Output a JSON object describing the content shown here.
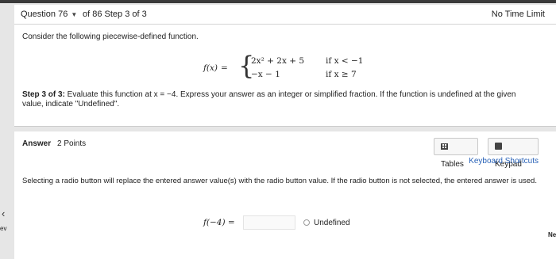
{
  "header": {
    "question_label": "Question 76",
    "of_step": "of 86 Step 3 of 3",
    "time_limit": "No Time Limit"
  },
  "question": {
    "prompt": "Consider the following piecewise-defined function.",
    "function_name": "f(x)",
    "equals": "=",
    "case1_expr": "2x² + 2x + 5",
    "case1_cond": "if x < −1",
    "case2_expr": "−x − 1",
    "case2_cond": "if x ≥ 7",
    "step_label": "Step 3 of 3:",
    "step_text": " Evaluate this function at x = −4. Express your answer as an integer or simplified fraction. If the function is undefined at the given value, indicate \"Undefined\"."
  },
  "answer": {
    "label": "Answer",
    "points": "2 Points",
    "tables_label": "Tables",
    "keypad_label": "Keypad",
    "keyboard_shortcuts": "Keyboard Shortcuts",
    "note": "Selecting a radio button will replace the entered answer value(s) with the radio button value. If the radio button is not selected, the entered answer is used.",
    "expression": "f(−4) =",
    "input_value": "",
    "undefined_label": "Undefined"
  },
  "nav": {
    "prev_icon": "chevron-left-icon",
    "prev_label": "ev",
    "next_label": "Ne"
  },
  "colors": {
    "link": "#2a63b8",
    "background": "#e6e6e6"
  }
}
